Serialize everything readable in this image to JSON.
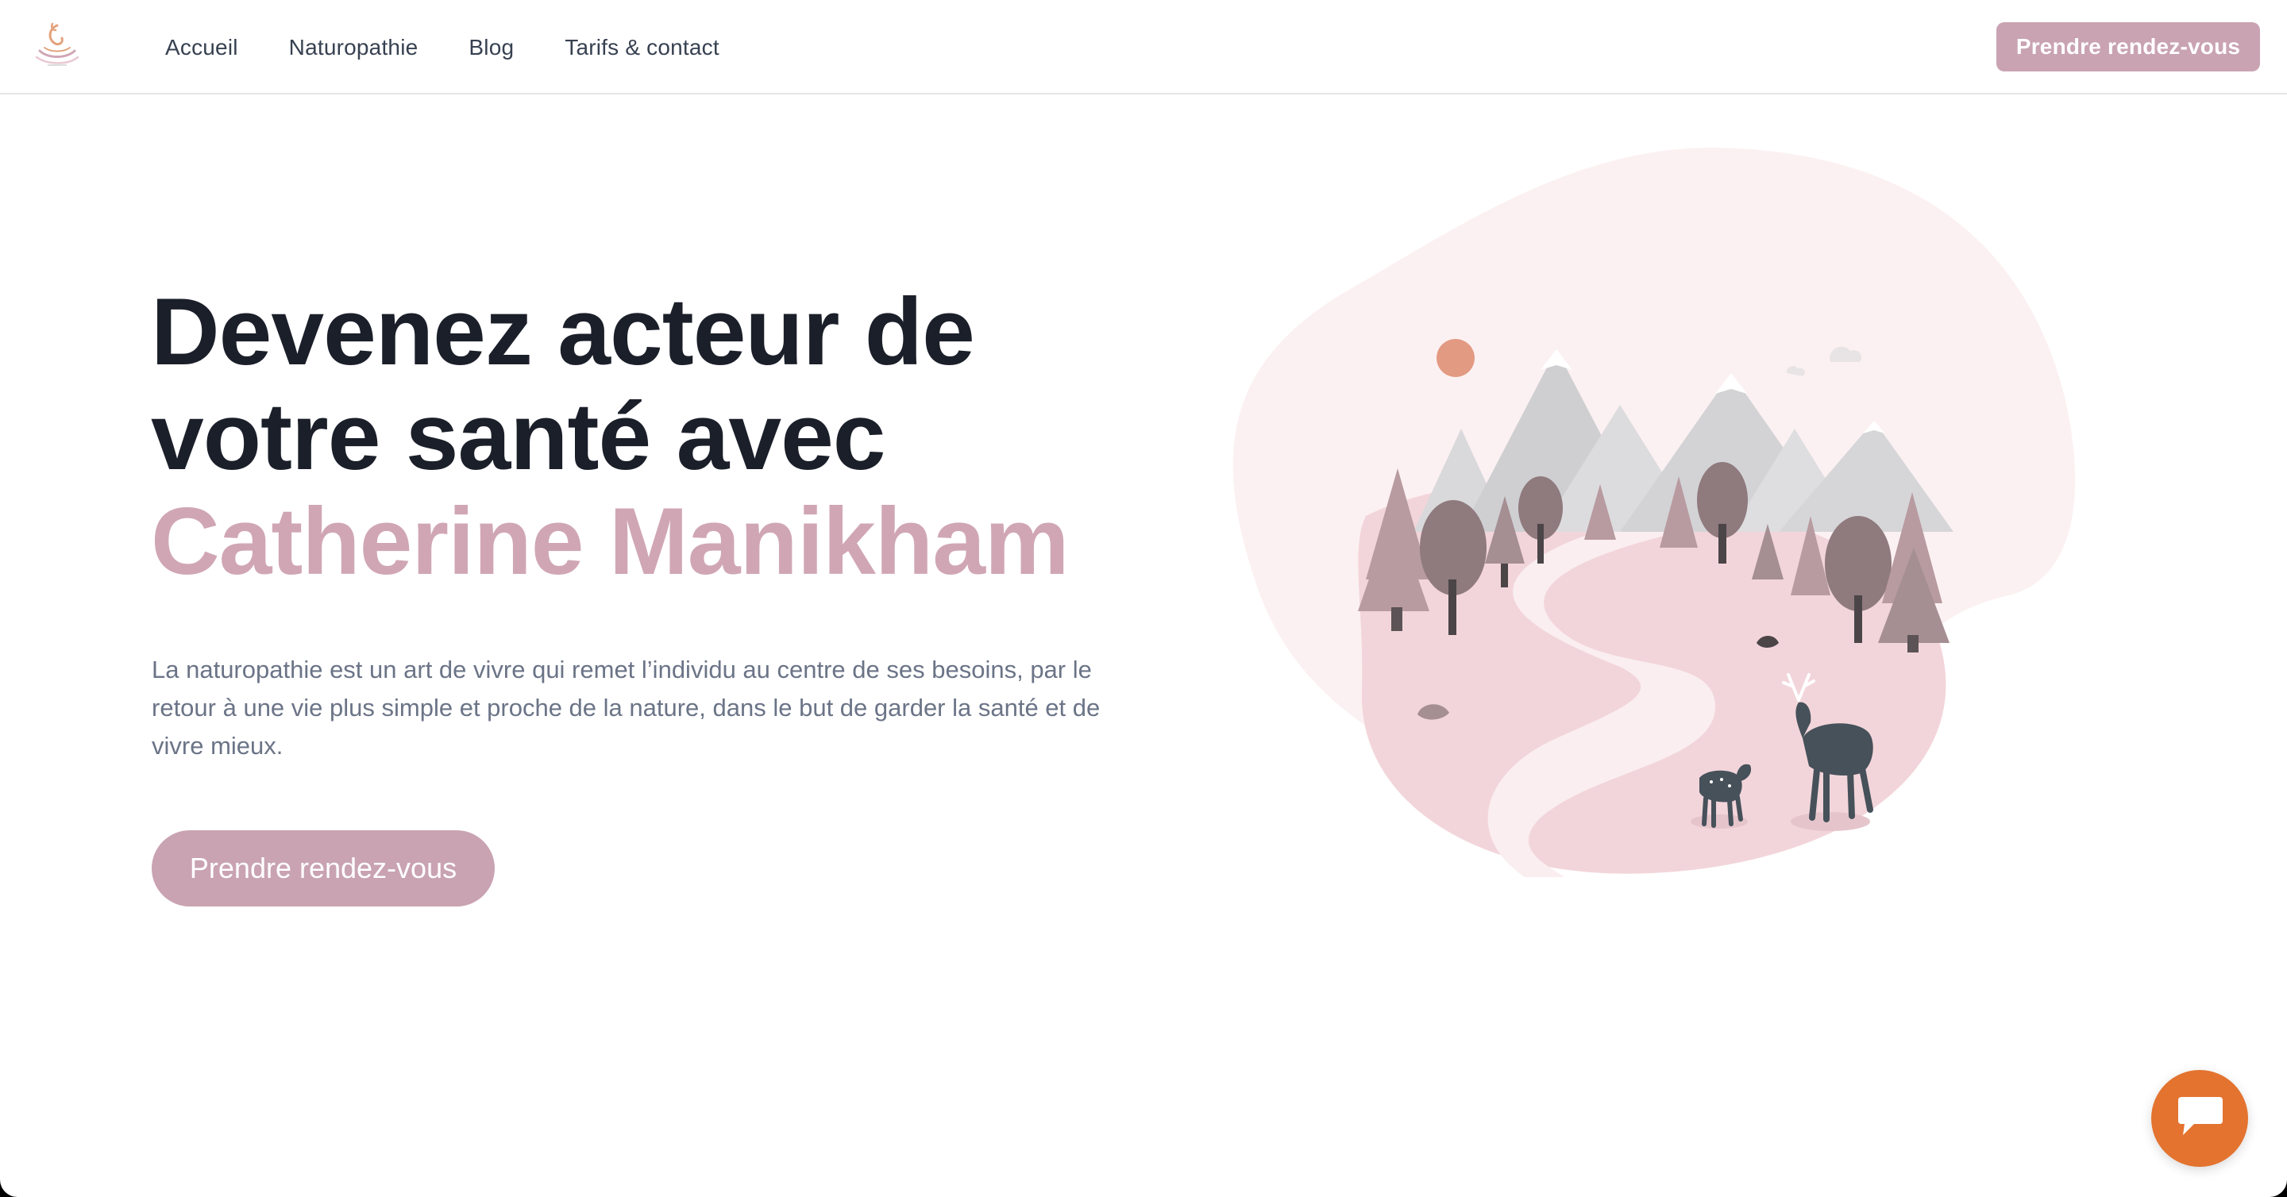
{
  "header": {
    "logo_icon": "lotus-swirl-logo",
    "nav": [
      {
        "label": "Accueil"
      },
      {
        "label": "Naturopathie"
      },
      {
        "label": "Blog"
      },
      {
        "label": "Tarifs & contact"
      }
    ],
    "cta_label": "Prendre rendez-vous"
  },
  "hero": {
    "title_line1": "Devenez acteur de",
    "title_line2": "votre santé avec",
    "title_name": "Catherine Manikham",
    "description": "La naturopathie est un art de vivre qui remet l’individu au centre de ses besoins, par le retour à une vie plus simple et proche de la nature, dans le but de garder la santé et de vivre mieux.",
    "cta_label": "Prendre rendez-vous",
    "illustration": "forest-path-deer-mountains-illustration"
  },
  "chat": {
    "icon": "chat-bubble-icon"
  },
  "colors": {
    "brand": "#c9a3b2",
    "name_text": "#d0a6b5",
    "title_text": "#1b1f2a",
    "body_text": "#6b7487",
    "chat_button": "#e3732f",
    "blob": "#fcf1f2"
  }
}
